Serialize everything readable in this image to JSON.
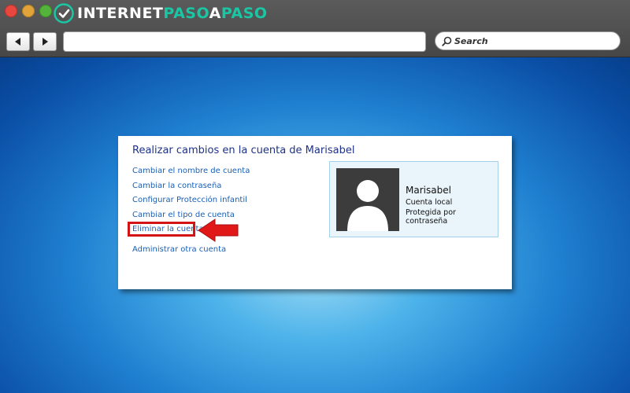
{
  "browser": {
    "brand": {
      "part1": "INTERNET",
      "part2": "PASO",
      "part3": "A",
      "part4": "PASO"
    },
    "search_label": "Search",
    "url_value": ""
  },
  "panel": {
    "title": "Realizar cambios en la cuenta de Marisabel",
    "links": [
      "Cambiar el nombre de cuenta",
      "Cambiar la contraseña",
      "Configurar Protección infantil",
      "Cambiar el tipo de cuenta",
      "Eliminar la cuenta",
      "Administrar otra cuenta"
    ]
  },
  "account": {
    "name": "Marisabel",
    "type": "Cuenta local",
    "protection": "Protegida por contraseña"
  },
  "colors": {
    "highlight": "#d41414",
    "link": "#1a5fb4",
    "title": "#1e3287",
    "brand_accent": "#19c7a4"
  }
}
